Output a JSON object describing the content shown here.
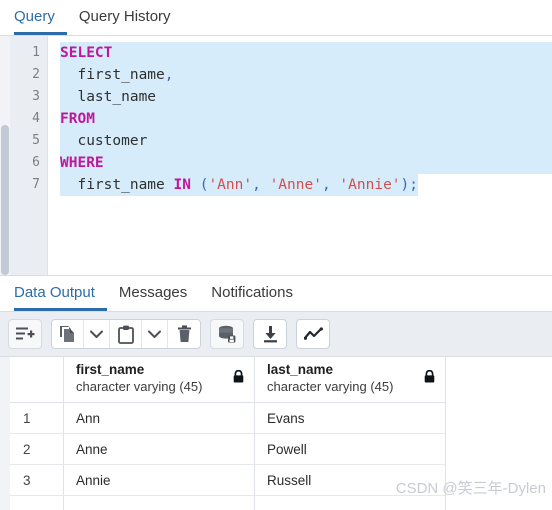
{
  "editor_tabs": {
    "items": [
      {
        "label": "Query",
        "active": true
      },
      {
        "label": "Query History",
        "active": false
      }
    ]
  },
  "editor": {
    "line_numbers": [
      "1",
      "2",
      "3",
      "4",
      "5",
      "6",
      "7"
    ],
    "lines": [
      {
        "num": "1",
        "tokens": [
          {
            "t": "SELECT",
            "k": "kw"
          }
        ]
      },
      {
        "num": "2",
        "tokens": [
          {
            "t": "  first_name",
            "k": "idn"
          },
          {
            "t": ",",
            "k": "punc"
          }
        ]
      },
      {
        "num": "3",
        "tokens": [
          {
            "t": "  last_name",
            "k": "idn"
          }
        ]
      },
      {
        "num": "4",
        "tokens": [
          {
            "t": "FROM",
            "k": "kw"
          }
        ]
      },
      {
        "num": "5",
        "tokens": [
          {
            "t": "  customer",
            "k": "idn"
          }
        ]
      },
      {
        "num": "6",
        "tokens": [
          {
            "t": "WHERE",
            "k": "kw"
          }
        ]
      },
      {
        "num": "7",
        "tokens": [
          {
            "t": "  first_name ",
            "k": "idn"
          },
          {
            "t": "IN",
            "k": "kw"
          },
          {
            "t": " (",
            "k": "punc"
          },
          {
            "t": "'Ann'",
            "k": "str"
          },
          {
            "t": ", ",
            "k": "punc"
          },
          {
            "t": "'Anne'",
            "k": "str"
          },
          {
            "t": ", ",
            "k": "punc"
          },
          {
            "t": "'Annie'",
            "k": "str"
          },
          {
            "t": ");",
            "k": "punc"
          }
        ]
      }
    ],
    "full_text": "SELECT\n  first_name,\n  last_name\nFROM\n  customer\nWHERE\n  first_name IN ('Ann', 'Anne', 'Annie');",
    "selection_color": "#d6ecfb",
    "keyword_color": "#c0169b",
    "string_color": "#d14f4f"
  },
  "output_tabs": {
    "items": [
      {
        "label": "Data Output",
        "active": true
      },
      {
        "label": "Messages",
        "active": false
      },
      {
        "label": "Notifications",
        "active": false
      }
    ],
    "accent_color": "#2c6ca8"
  },
  "toolbar": {
    "groups": [
      {
        "buttons": [
          {
            "icon": "add-row-icon",
            "label": "Add row"
          }
        ]
      },
      {
        "buttons": [
          {
            "icon": "copy-icon",
            "label": "Copy"
          },
          {
            "icon": "chevron-down-icon",
            "label": "Copy options"
          },
          {
            "icon": "paste-icon",
            "label": "Paste"
          },
          {
            "icon": "chevron-down-icon",
            "label": "Paste options"
          },
          {
            "icon": "delete-icon",
            "label": "Delete"
          }
        ]
      },
      {
        "buttons": [
          {
            "icon": "save-data-icon",
            "label": "Save data changes"
          }
        ]
      },
      {
        "buttons": [
          {
            "icon": "download-icon",
            "label": "Download as CSV"
          }
        ]
      },
      {
        "buttons": [
          {
            "icon": "graph-visualiser-icon",
            "label": "Graph Visualiser"
          }
        ]
      }
    ]
  },
  "results": {
    "row_number_header": "",
    "columns": [
      {
        "name": "first_name",
        "type": "character varying (45)",
        "locked": true
      },
      {
        "name": "last_name",
        "type": "character varying (45)",
        "locked": true
      }
    ],
    "rows": [
      {
        "num": "1",
        "first_name": "Ann",
        "last_name": "Evans"
      },
      {
        "num": "2",
        "first_name": "Anne",
        "last_name": "Powell"
      },
      {
        "num": "3",
        "first_name": "Annie",
        "last_name": "Russell"
      }
    ]
  },
  "watermark": {
    "text": "CSDN @笑三年-Dylen"
  }
}
